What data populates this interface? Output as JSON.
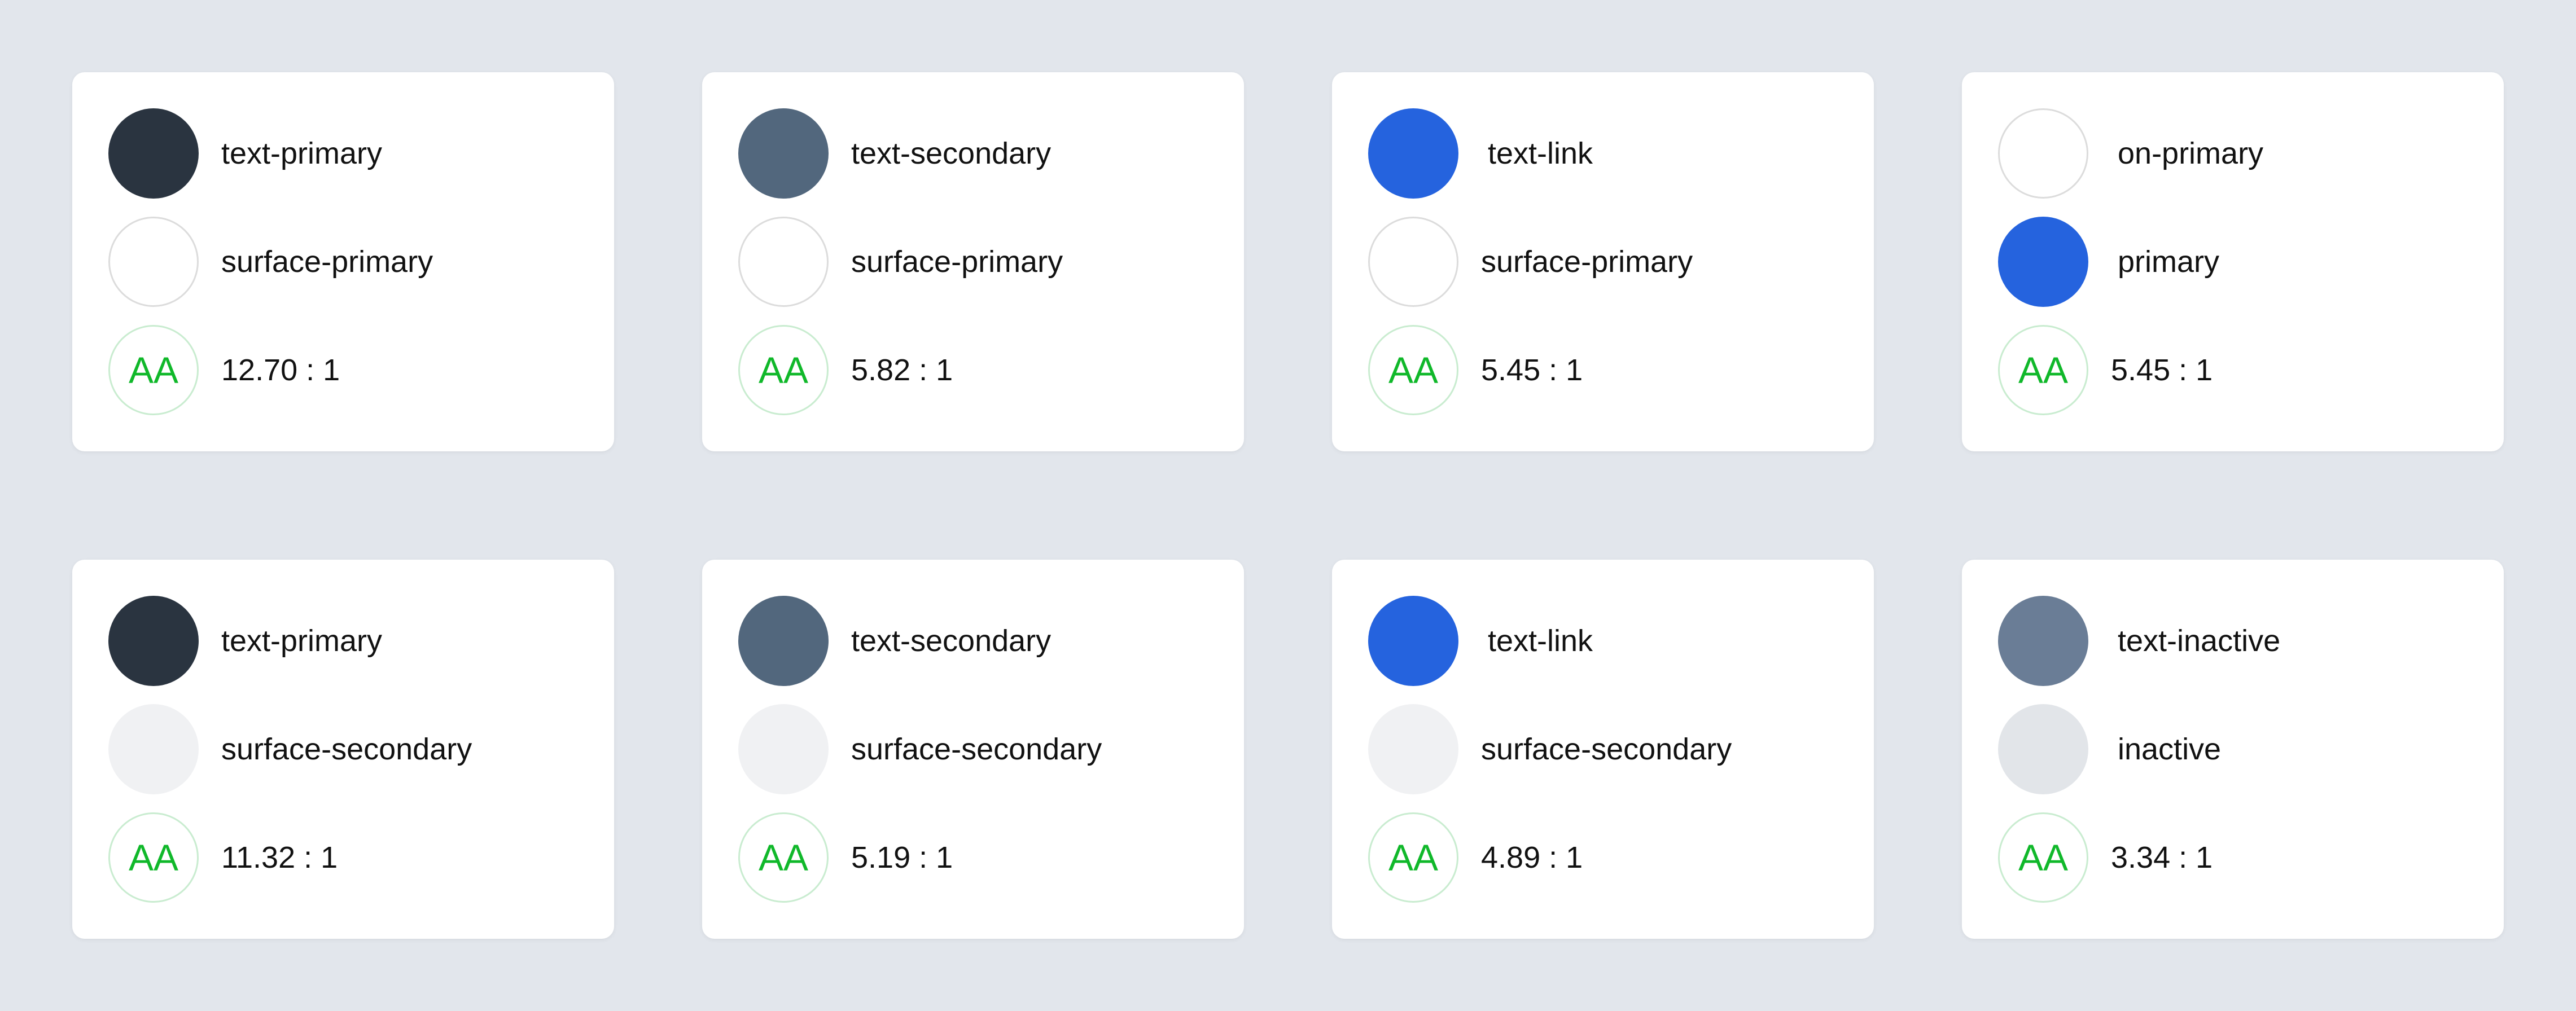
{
  "badge_text": "AA",
  "colors": {
    "background": "#e2e6ec",
    "card": "#ffffff",
    "badge_green": "#10b82a"
  },
  "cards": [
    {
      "foreground": {
        "name": "text-primary",
        "color": "#2a3440"
      },
      "background": {
        "name": "surface-primary",
        "color": "#ffffff"
      },
      "ratio": "12.70 : 1"
    },
    {
      "foreground": {
        "name": "text-secondary",
        "color": "#52677d"
      },
      "background": {
        "name": "surface-primary",
        "color": "#ffffff"
      },
      "ratio": "5.82 : 1"
    },
    {
      "foreground": {
        "name": "text-link",
        "color": "#2563de"
      },
      "background": {
        "name": "surface-primary",
        "color": "#ffffff"
      },
      "ratio": "5.45 : 1"
    },
    {
      "foreground": {
        "name": "on-primary",
        "color": "#ffffff"
      },
      "background": {
        "name": "primary",
        "color": "#2563de"
      },
      "ratio": "5.45 : 1"
    },
    {
      "foreground": {
        "name": "text-primary",
        "color": "#2a3440"
      },
      "background": {
        "name": "surface-secondary",
        "color": "#f0f1f3"
      },
      "ratio": "11.32 : 1"
    },
    {
      "foreground": {
        "name": "text-secondary",
        "color": "#52677d"
      },
      "background": {
        "name": "surface-secondary",
        "color": "#f0f1f3"
      },
      "ratio": "5.19 : 1"
    },
    {
      "foreground": {
        "name": "text-link",
        "color": "#2563de"
      },
      "background": {
        "name": "surface-secondary",
        "color": "#f0f1f3"
      },
      "ratio": "4.89 : 1"
    },
    {
      "foreground": {
        "name": "text-inactive",
        "color": "#6a7d96"
      },
      "background": {
        "name": "inactive",
        "color": "#e2e5e9"
      },
      "ratio": "3.34 : 1"
    }
  ]
}
